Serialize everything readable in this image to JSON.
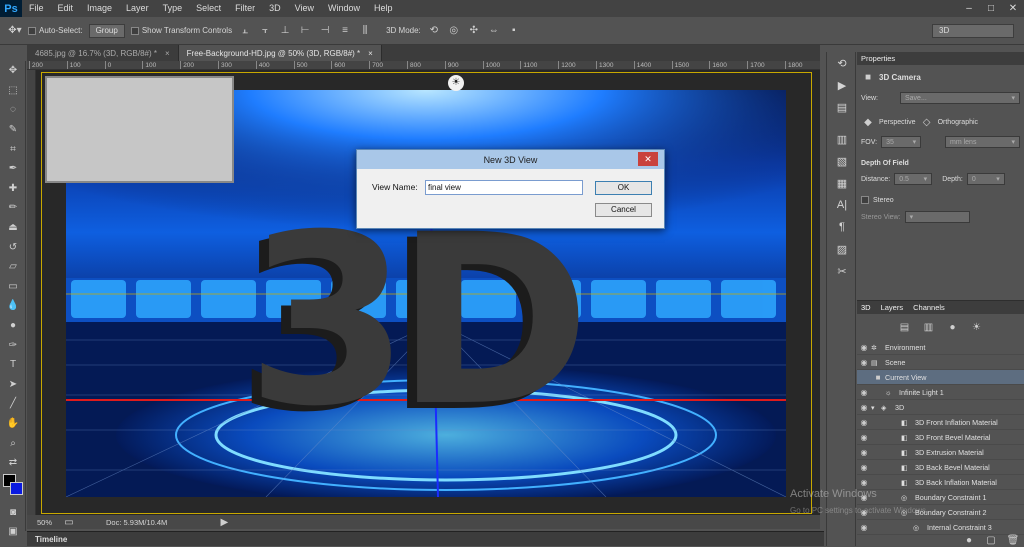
{
  "app": {
    "logo": "Ps",
    "menu": [
      "File",
      "Edit",
      "Image",
      "Layer",
      "Type",
      "Select",
      "Filter",
      "3D",
      "View",
      "Window",
      "Help"
    ],
    "window_controls": [
      "–",
      "□",
      "✕"
    ]
  },
  "options": {
    "auto_select_label": "Auto-Select:",
    "auto_select_value": "Group",
    "show_transform_label": "Show Transform Controls",
    "mode_label": "3D Mode:",
    "workspace": "3D"
  },
  "tabs": [
    {
      "label": "4685.jpg @ 16.7% (3D, RGB/8#) *"
    },
    {
      "label": "Free-Background-HD.jpg @ 50% (3D, RGB/8#) *"
    }
  ],
  "ruler": {
    "ticks": [
      "200",
      "100",
      "0",
      "100",
      "200",
      "300",
      "400",
      "500",
      "600",
      "700",
      "800",
      "900",
      "1000",
      "1100",
      "1200",
      "1300",
      "1400",
      "1500",
      "1600",
      "1700",
      "1800"
    ]
  },
  "scene": {
    "text": "3D"
  },
  "status": {
    "zoom": "50%",
    "doc": "Doc: 5.93M/10.4M"
  },
  "timeline": {
    "label": "Timeline"
  },
  "properties": {
    "title": "Properties",
    "header": "3D Camera",
    "view_label": "View:",
    "view_value": "Save...",
    "perspective": "Perspective",
    "orthographic": "Orthographic",
    "fov_label": "FOV:",
    "fov_value": "35",
    "fov_unit": "mm lens",
    "dof_label": "Depth Of Field",
    "distance_label": "Distance:",
    "distance_value": "0.5",
    "depth_label": "Depth:",
    "depth_value": "0",
    "stereo_label": "Stereo",
    "stereo_view_label": "Stereo View:"
  },
  "panel3d": {
    "tabs": [
      "3D",
      "Layers",
      "Channels"
    ],
    "items": [
      {
        "label": "Environment"
      },
      {
        "label": "Scene"
      },
      {
        "label": "Current View"
      },
      {
        "label": "Infinite Light 1"
      },
      {
        "label": "3D"
      },
      {
        "label": "3D Front Inflation Material"
      },
      {
        "label": "3D Front Bevel Material"
      },
      {
        "label": "3D Extrusion Material"
      },
      {
        "label": "3D Back Bevel Material"
      },
      {
        "label": "3D Back Inflation Material"
      },
      {
        "label": "Boundary Constraint 1"
      },
      {
        "label": "Boundary Constraint 2"
      },
      {
        "label": "Internal Constraint 3"
      }
    ]
  },
  "dialog": {
    "title": "New 3D View",
    "label": "View Name:",
    "value": "final view",
    "ok": "OK",
    "cancel": "Cancel"
  },
  "watermark": {
    "line1": "Activate Windows",
    "line2": "Go to PC settings to activate Windows."
  }
}
